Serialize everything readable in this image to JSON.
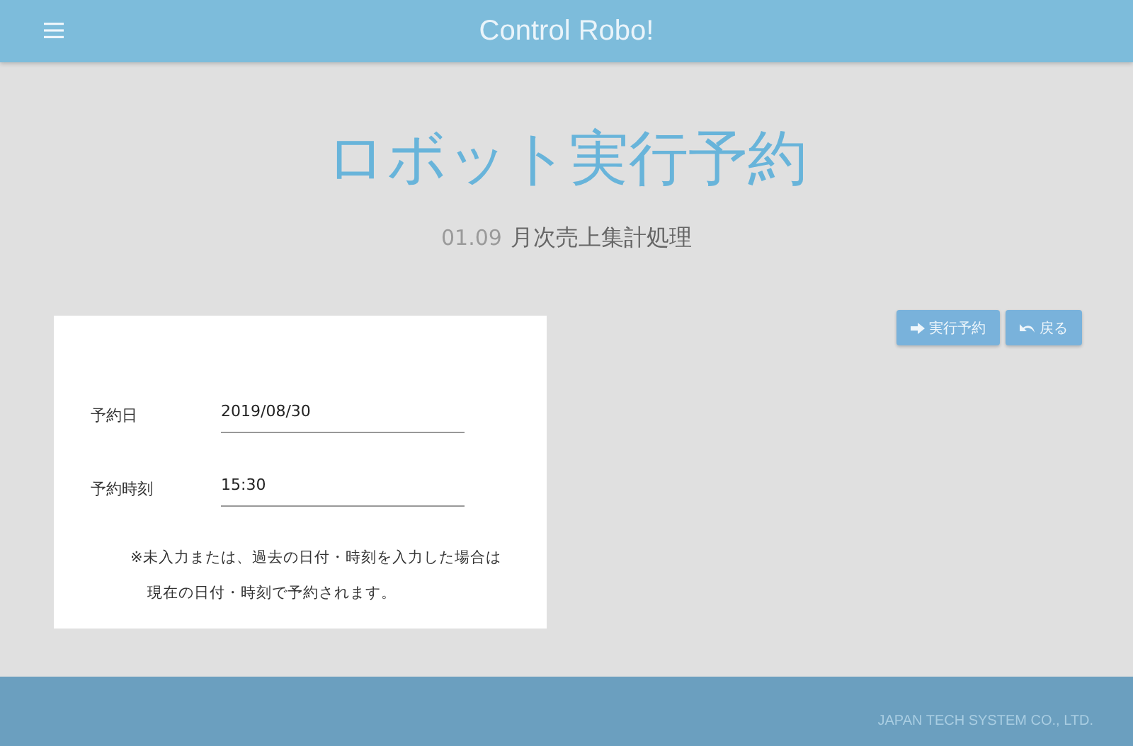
{
  "header": {
    "title": "Control Robo!"
  },
  "page": {
    "title": "ロボット実行予約",
    "job_code": "01.09",
    "job_name": "月次売上集計処理"
  },
  "form": {
    "fields": [
      {
        "label": "予約日",
        "value": "2019/08/30"
      },
      {
        "label": "予約時刻",
        "value": "15:30"
      }
    ],
    "notes": [
      "※未入力または、過去の日付・時刻を入力した場合は",
      "現在の日付・時刻で予約されます。"
    ]
  },
  "buttons": [
    {
      "label": "実行予約",
      "kind": "submit"
    },
    {
      "label": "戻る",
      "kind": "back"
    }
  ],
  "footer": {
    "text": "JAPAN TECH SYSTEM CO., LTD."
  }
}
